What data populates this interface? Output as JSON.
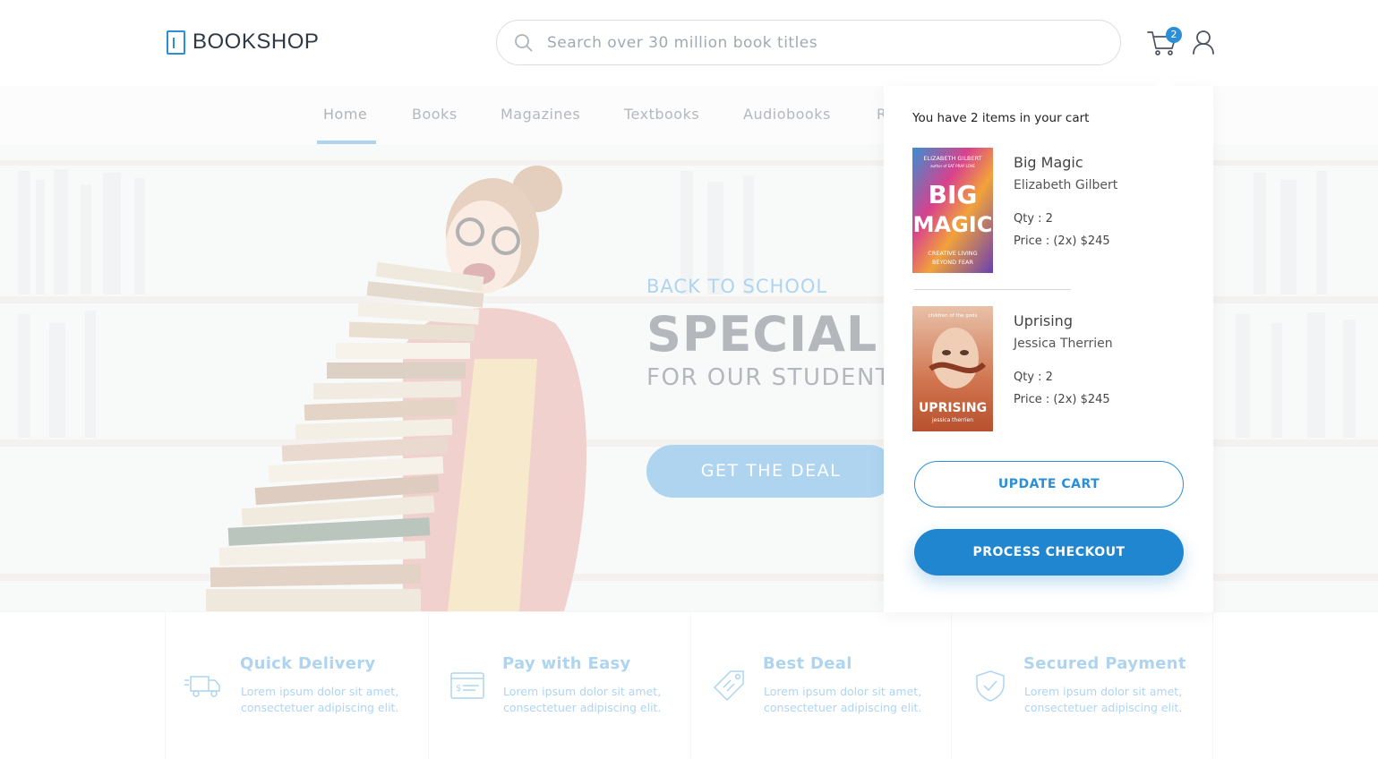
{
  "header": {
    "logo_text": "BOOKSHOP",
    "search_placeholder": "Search over 30 million book titles",
    "cart_count": "2"
  },
  "nav": {
    "items": [
      "Home",
      "Books",
      "Magazines",
      "Textbooks",
      "Audiobooks",
      "R"
    ],
    "active": "Home"
  },
  "hero": {
    "kicker": "BACK TO SCHOOL",
    "title": "SPECIAL",
    "subtitle": "FOR OUR STUDENT",
    "cta": "GET THE DEAL"
  },
  "features": [
    {
      "title": "Quick Delivery",
      "desc": "Lorem ipsum dolor sit amet, consectetuer adipiscing elit.",
      "icon": "truck-icon"
    },
    {
      "title": "Pay with Easy",
      "desc": "Lorem ipsum dolor sit amet, consectetuer adipiscing elit.",
      "icon": "cheque-icon"
    },
    {
      "title": "Best Deal",
      "desc": "Lorem ipsum dolor sit amet, consectetuer adipiscing elit.",
      "icon": "tag-icon"
    },
    {
      "title": "Secured Payment",
      "desc": "Lorem ipsum dolor sit amet, consectetuer adipiscing elit.",
      "icon": "shield-check-icon"
    }
  ],
  "cart": {
    "header": "You have 2 items in your cart",
    "items": [
      {
        "title": "Big Magic",
        "author": "Elizabeth Gilbert",
        "qty": "Qty : 2",
        "price": "Price : (2x) $245",
        "cover_author": "ELIZABETH GILBERT",
        "cover_tagline": "author of EAT PRAY LOVE",
        "cover_title_1": "BIG",
        "cover_title_2": "MAGIC",
        "cover_subtitle_1": "CREATIVE LIVING",
        "cover_subtitle_2": "BEYOND FEAR"
      },
      {
        "title": "Uprising",
        "author": "Jessica Therrien",
        "qty": "Qty : 2",
        "price": "Price : (2x) $245",
        "cover_top": "children of the gods",
        "cover_title": "UPRISING",
        "cover_author": "jessica therrien"
      }
    ],
    "update_label": "UPDATE CART",
    "checkout_label": "PROCESS CHECKOUT"
  },
  "colors": {
    "accent": "#2a8fd8",
    "checkout": "#1f86cf",
    "text_dark": "#2f3a45"
  }
}
